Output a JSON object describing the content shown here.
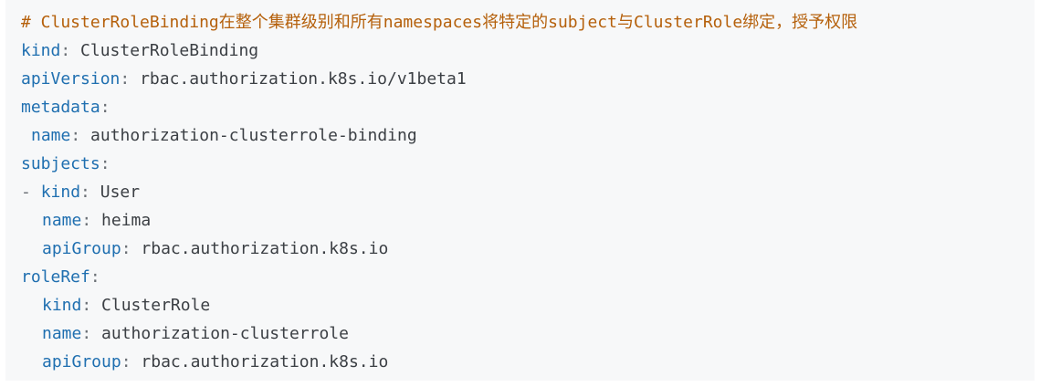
{
  "code": {
    "comment": "# ClusterRoleBinding在整个集群级别和所有namespaces将特定的subject与ClusterRole绑定，授予权限",
    "lines": [
      {
        "key": "kind",
        "value": "ClusterRoleBinding"
      },
      {
        "key": "apiVersion",
        "value": "rbac.authorization.k8s.io/v1beta1"
      },
      {
        "key": "metadata",
        "value": ""
      },
      {
        "key": "name",
        "value": "authorization-clusterrole-binding"
      },
      {
        "key": "subjects",
        "value": ""
      },
      {
        "prefix": "- ",
        "key": "kind",
        "value": "User"
      },
      {
        "key": "name",
        "value": "heima"
      },
      {
        "key": "apiGroup",
        "value": "rbac.authorization.k8s.io"
      },
      {
        "key": "roleRef",
        "value": ""
      },
      {
        "key": "kind",
        "value": "ClusterRole"
      },
      {
        "key": "name",
        "value": "authorization-clusterrole"
      },
      {
        "key": "apiGroup",
        "value": "rbac.authorization.k8s.io"
      }
    ],
    "separator": ": ",
    "separator_bare": ":"
  }
}
